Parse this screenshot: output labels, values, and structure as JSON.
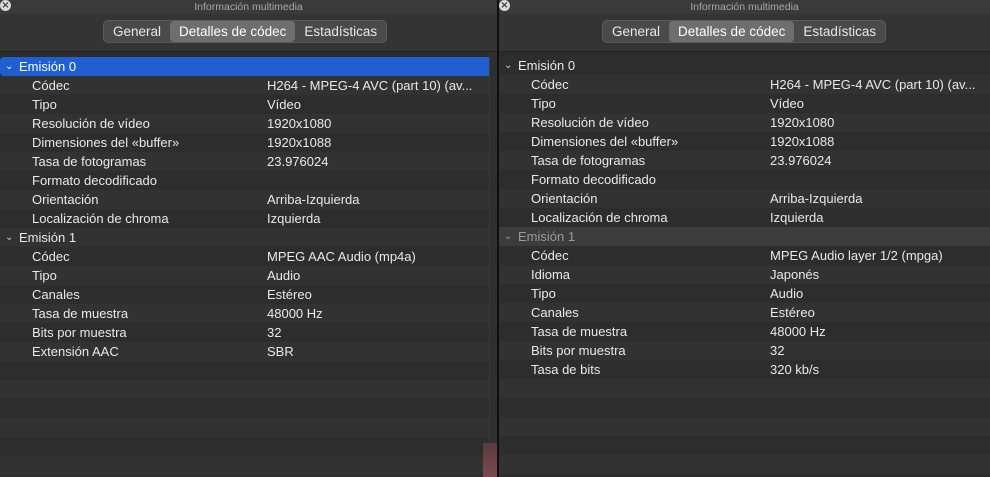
{
  "window_title": "Información multimedia",
  "tabs": [
    "General",
    "Detalles de códec",
    "Estadísticas"
  ],
  "active_tab": "Detalles de códec",
  "left_panel": {
    "streams": [
      {
        "title": "Emisión 0",
        "rows": [
          {
            "k": "Códec",
            "v": "H264 - MPEG-4 AVC (part 10) (av..."
          },
          {
            "k": "Tipo",
            "v": "Vídeo"
          },
          {
            "k": "Resolución de vídeo",
            "v": "1920x1080"
          },
          {
            "k": "Dimensiones del «buffer»",
            "v": "1920x1088"
          },
          {
            "k": "Tasa de fotogramas",
            "v": "23.976024"
          },
          {
            "k": "Formato decodificado",
            "v": ""
          },
          {
            "k": "Orientación",
            "v": "Arriba-Izquierda"
          },
          {
            "k": "Localización de chroma",
            "v": "Izquierda"
          }
        ]
      },
      {
        "title": "Emisión 1",
        "rows": [
          {
            "k": "Códec",
            "v": "MPEG AAC Audio (mp4a)"
          },
          {
            "k": "Tipo",
            "v": "Audio"
          },
          {
            "k": "Canales",
            "v": "Estéreo"
          },
          {
            "k": "Tasa de muestra",
            "v": "48000 Hz"
          },
          {
            "k": "Bits por muestra",
            "v": "32"
          },
          {
            "k": "Extensión AAC",
            "v": "SBR"
          }
        ]
      }
    ]
  },
  "right_panel": {
    "streams": [
      {
        "title": "Emisión 0",
        "rows": [
          {
            "k": "Códec",
            "v": "H264 - MPEG-4 AVC (part 10) (av..."
          },
          {
            "k": "Tipo",
            "v": "Vídeo"
          },
          {
            "k": "Resolución de vídeo",
            "v": "1920x1080"
          },
          {
            "k": "Dimensiones del «buffer»",
            "v": "1920x1088"
          },
          {
            "k": "Tasa de fotogramas",
            "v": "23.976024"
          },
          {
            "k": "Formato decodificado",
            "v": ""
          },
          {
            "k": "Orientación",
            "v": "Arriba-Izquierda"
          },
          {
            "k": "Localización de chroma",
            "v": "Izquierda"
          }
        ]
      },
      {
        "title": "Emisión 1",
        "rows": [
          {
            "k": "Códec",
            "v": "MPEG Audio layer 1/2 (mpga)"
          },
          {
            "k": "Idioma",
            "v": "Japonés"
          },
          {
            "k": "Tipo",
            "v": "Audio"
          },
          {
            "k": "Canales",
            "v": "Estéreo"
          },
          {
            "k": "Tasa de muestra",
            "v": "48000 Hz"
          },
          {
            "k": "Bits por muestra",
            "v": "32"
          },
          {
            "k": "Tasa de bits",
            "v": "320 kb/s"
          }
        ]
      }
    ]
  },
  "colors": {
    "selection": "#1f5fd1",
    "background": "#2b2b2b"
  },
  "icons": {
    "close": "close-icon",
    "expand": "chevron-down-icon"
  }
}
